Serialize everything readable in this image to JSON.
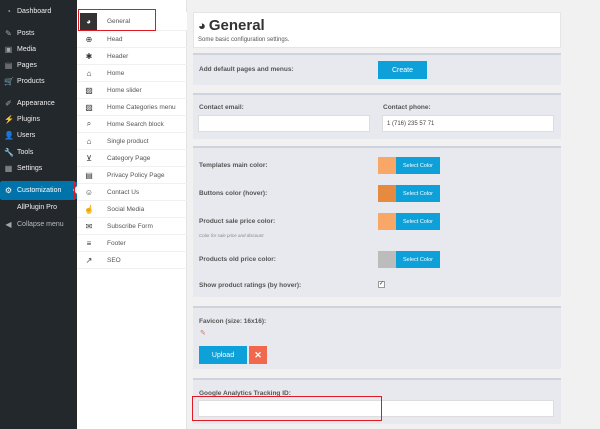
{
  "wp_sidebar": {
    "items": [
      {
        "label": "Dashboard",
        "icon": "dashboard-icon",
        "glyph": "◔"
      },
      {
        "label": "Posts",
        "icon": "pin-icon",
        "glyph": "✎"
      },
      {
        "label": "Media",
        "icon": "media-icon",
        "glyph": "▣"
      },
      {
        "label": "Pages",
        "icon": "pages-icon",
        "glyph": "▤"
      },
      {
        "label": "Products",
        "icon": "cart-icon",
        "glyph": "🛒"
      },
      {
        "label": "Appearance",
        "icon": "brush-icon",
        "glyph": "✐"
      },
      {
        "label": "Plugins",
        "icon": "plug-icon",
        "glyph": "⚡"
      },
      {
        "label": "Users",
        "icon": "users-icon",
        "glyph": "👤"
      },
      {
        "label": "Tools",
        "icon": "wrench-icon",
        "glyph": "🔧"
      },
      {
        "label": "Settings",
        "icon": "settings-icon",
        "glyph": "▦"
      },
      {
        "label": "Customization",
        "icon": "gear-icon",
        "glyph": "⚙"
      },
      {
        "label": "AllPlugin Pro",
        "icon": "none",
        "glyph": ""
      },
      {
        "label": "Collapse menu",
        "icon": "collapse-icon",
        "glyph": "◀"
      }
    ]
  },
  "sub_nav": {
    "items": [
      {
        "label": "General",
        "icon": "gauge-icon",
        "glyph": "◕"
      },
      {
        "label": "Head",
        "icon": "globe-icon",
        "glyph": "⊕"
      },
      {
        "label": "Header",
        "icon": "cog-icon",
        "glyph": "✱"
      },
      {
        "label": "Home",
        "icon": "home-icon",
        "glyph": "⌂"
      },
      {
        "label": "Home slider",
        "icon": "image-icon",
        "glyph": "▨"
      },
      {
        "label": "Home Categories menu",
        "icon": "image-icon",
        "glyph": "▨"
      },
      {
        "label": "Home Search block",
        "icon": "search-icon",
        "glyph": "⌕"
      },
      {
        "label": "Single product",
        "icon": "home-icon",
        "glyph": "⌂"
      },
      {
        "label": "Category Page",
        "icon": "cart-icon",
        "glyph": "⊻"
      },
      {
        "label": "Privacy Policy Page",
        "icon": "document-icon",
        "glyph": "▤"
      },
      {
        "label": "Contact Us",
        "icon": "smiley-icon",
        "glyph": "☺"
      },
      {
        "label": "Social Media",
        "icon": "thumbs-up-icon",
        "glyph": "☝"
      },
      {
        "label": "Subscribe Form",
        "icon": "envelope-icon",
        "glyph": "✉"
      },
      {
        "label": "Footer",
        "icon": "bars-icon",
        "glyph": "≡"
      },
      {
        "label": "SEO",
        "icon": "chart-icon",
        "glyph": "↗"
      }
    ]
  },
  "header": {
    "title": "General",
    "subtitle": "Some basic configuration settings."
  },
  "pages_panel": {
    "label": "Add default pages and menus:",
    "button": "Create"
  },
  "contact_panel": {
    "email_label": "Contact email:",
    "email_value": "",
    "phone_label": "Contact phone:",
    "phone_value": "1 (716) 235 57 71"
  },
  "colors_panel": {
    "select_label": "Select Color",
    "rows": [
      {
        "label": "Templates main color:",
        "swatch": "#f8a766",
        "note": ""
      },
      {
        "label": "Buttons color (hover):",
        "swatch": "#e58a3f",
        "note": ""
      },
      {
        "label": "Product sale price color:",
        "swatch": "#f8a766",
        "note": "Color for sale price and discount"
      },
      {
        "label": "Products old price color:",
        "swatch": "#bcbcbc",
        "note": ""
      }
    ],
    "ratings_label": "Show product ratings (by hover):",
    "ratings_checked": "✓"
  },
  "favicon_panel": {
    "label": "Favicon (size: 16x16):",
    "upload_label": "Upload",
    "remove_label": "✕"
  },
  "analytics_panel": {
    "label": "Google Analytics Tracking ID:",
    "value": ""
  }
}
